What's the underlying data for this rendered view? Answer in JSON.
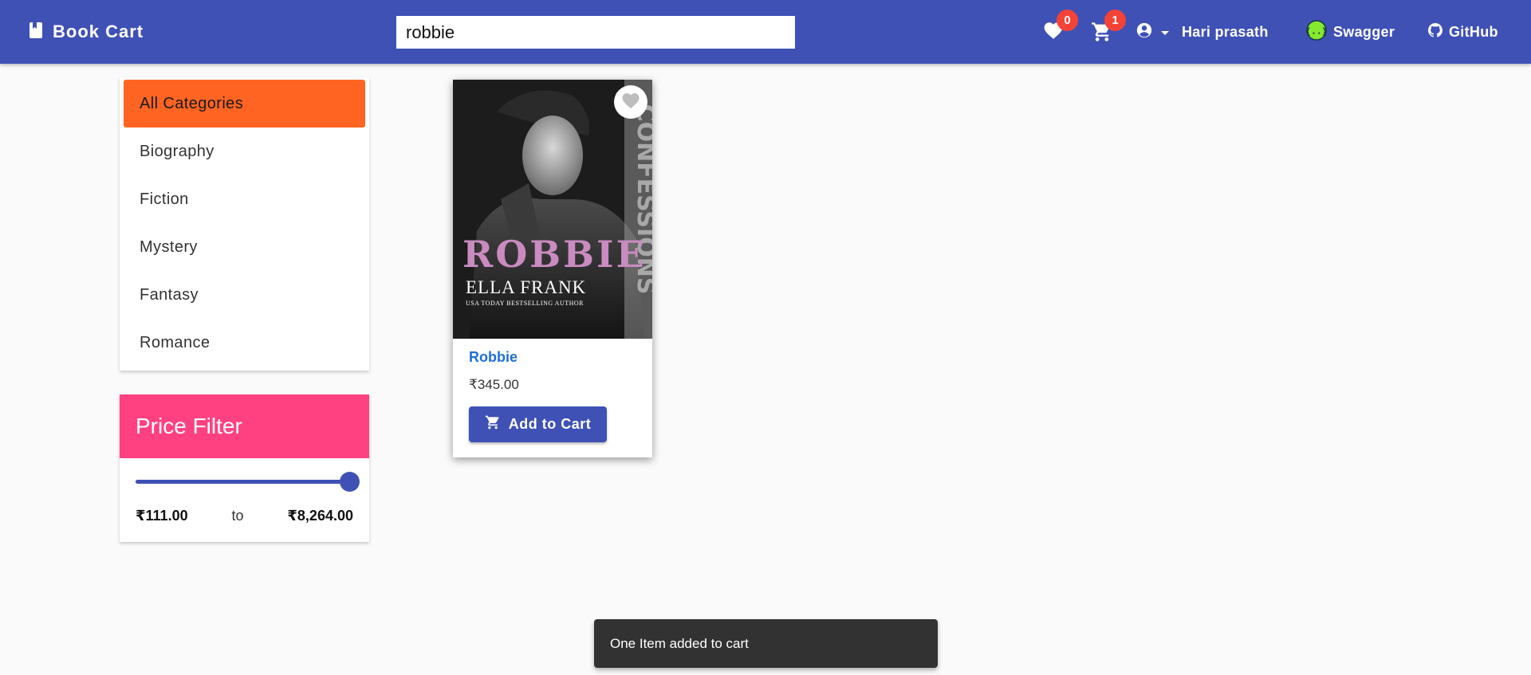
{
  "header": {
    "brand": "Book Cart",
    "search_value": "robbie",
    "wishlist_count": "0",
    "cart_count": "1",
    "user_name": "Hari prasath",
    "swagger_label": "Swagger",
    "github_label": "GitHub"
  },
  "categories": {
    "items": [
      "All Categories",
      "Biography",
      "Fiction",
      "Mystery",
      "Fantasy",
      "Romance"
    ],
    "active": "All Categories"
  },
  "price_filter": {
    "title": "Price Filter",
    "min_label": "₹111.00",
    "to_label": "to",
    "max_label": "₹8,264.00",
    "slider_fraction": 1.0
  },
  "book": {
    "title": "Robbie",
    "price": "₹345.00",
    "add_label": "Add to Cart",
    "cover_title": "ROBBIE",
    "cover_author": "ELLA FRANK",
    "cover_tagline": "USA TODAY BESTSELLING AUTHOR"
  },
  "snackbar": {
    "message": "One Item added to cart"
  },
  "colors": {
    "primary": "#3f51b5",
    "accent_pink": "#ff4081",
    "active_category": "#ff6422",
    "badge": "#f44336"
  }
}
